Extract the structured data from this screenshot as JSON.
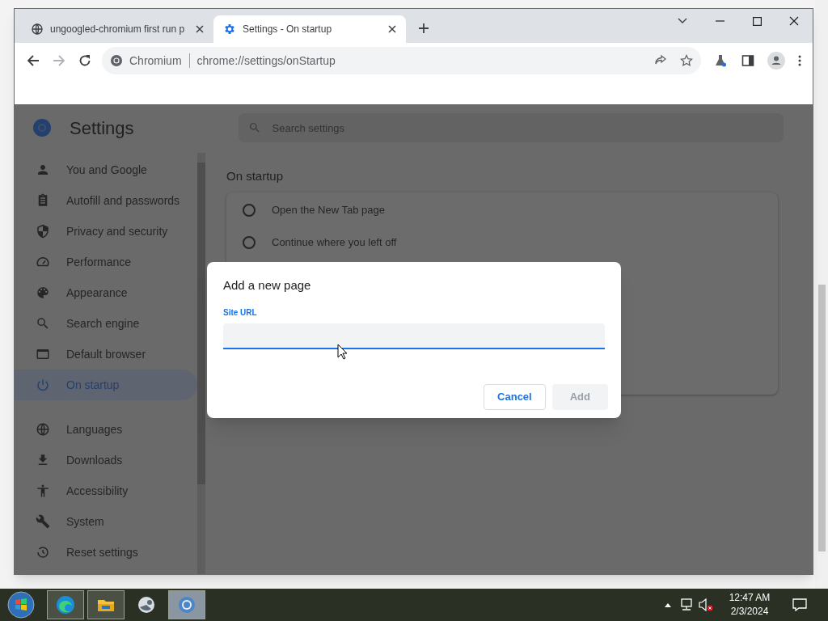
{
  "browser": {
    "tabs": [
      {
        "title": "ungoogled-chromium first run p",
        "kind": "globe",
        "selected": false
      },
      {
        "title": "Settings - On startup",
        "kind": "settings",
        "selected": true
      }
    ],
    "omnibox": {
      "chip": "Chromium",
      "url": "chrome://settings/onStartup"
    }
  },
  "settings": {
    "title": "Settings",
    "search": {
      "placeholder": "Search settings"
    },
    "sidebar": {
      "items": [
        {
          "label": "You and Google",
          "selected": false
        },
        {
          "label": "Autofill and passwords",
          "selected": false
        },
        {
          "label": "Privacy and security",
          "selected": false
        },
        {
          "label": "Performance",
          "selected": false
        },
        {
          "label": "Appearance",
          "selected": false
        },
        {
          "label": "Search engine",
          "selected": false
        },
        {
          "label": "Default browser",
          "selected": false
        },
        {
          "label": "On startup",
          "selected": true
        },
        {
          "label": "Languages",
          "selected": false
        },
        {
          "label": "Downloads",
          "selected": false
        },
        {
          "label": "Accessibility",
          "selected": false
        },
        {
          "label": "System",
          "selected": false
        },
        {
          "label": "Reset settings",
          "selected": false
        }
      ]
    },
    "section_title": "On startup",
    "options": [
      {
        "label": "Open the New Tab page",
        "selected": false
      },
      {
        "label": "Continue where you left off",
        "selected": false
      }
    ]
  },
  "dialog": {
    "title": "Add a new page",
    "field_label": "Site URL",
    "buttons": [
      {
        "label": "Cancel",
        "disabled": false
      },
      {
        "label": "Add",
        "disabled": true
      }
    ]
  },
  "taskbar": {
    "apps": [
      {
        "running": true,
        "selected": false
      },
      {
        "running": true,
        "selected": false
      },
      {
        "running": false,
        "selected": false
      },
      {
        "running": true,
        "selected": true
      }
    ],
    "time": "12:47 AM",
    "date": "2/3/2024"
  }
}
